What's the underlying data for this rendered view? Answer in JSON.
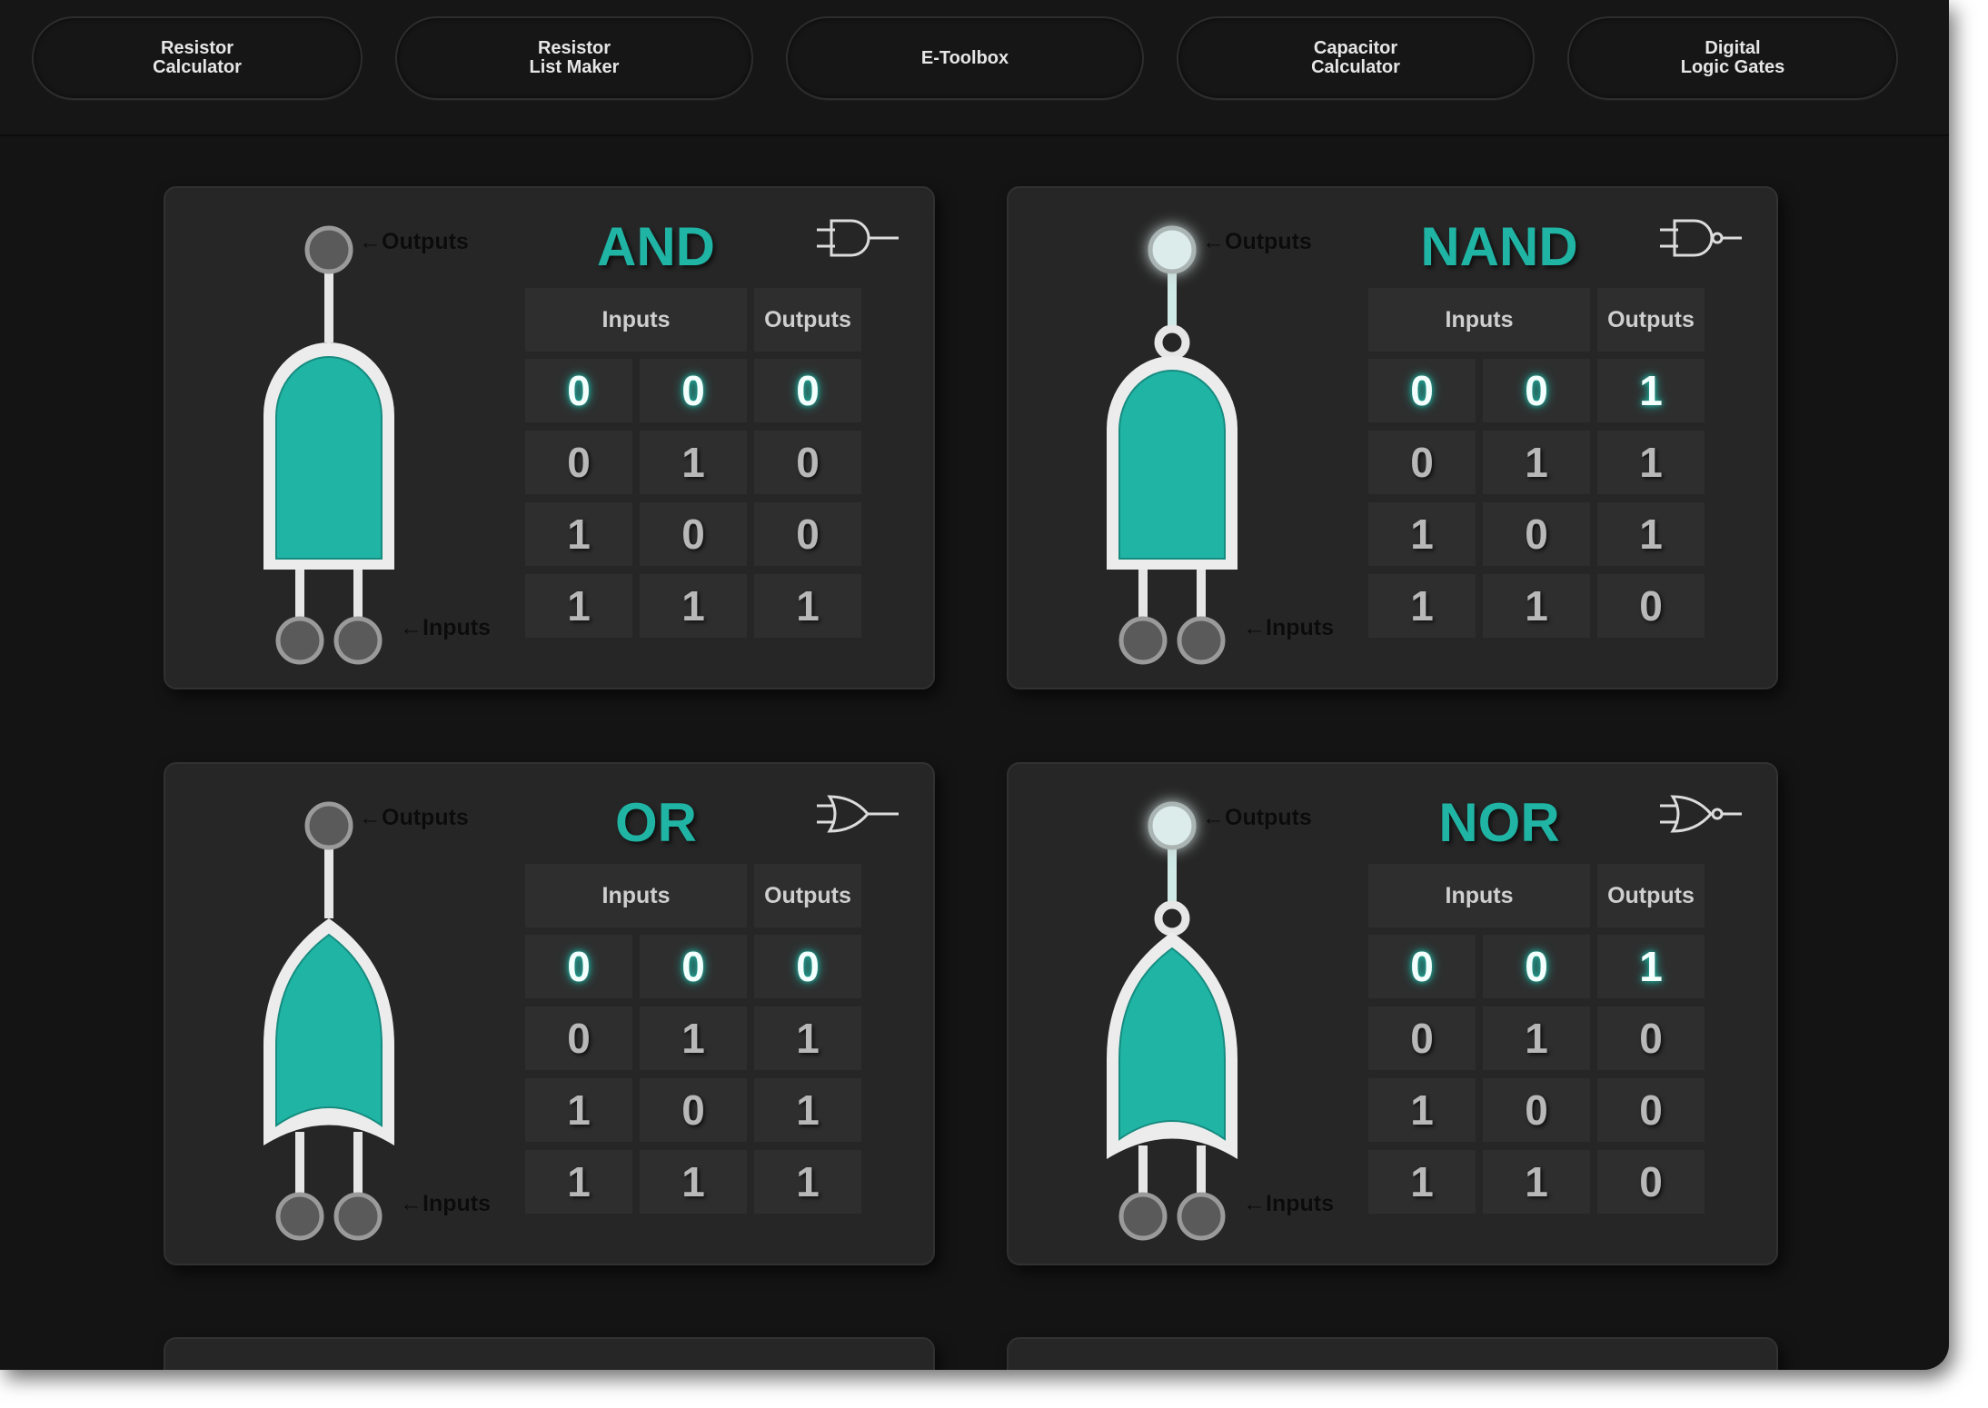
{
  "nav": [
    {
      "label": "Resistor\nCalculator"
    },
    {
      "label": "Resistor\nList Maker"
    },
    {
      "label": "E-Toolbox"
    },
    {
      "label": "Capacitor\nCalculator"
    },
    {
      "label": "Digital\nLogic Gates"
    }
  ],
  "labels": {
    "outputs": "←Outputs",
    "inputs": "←Inputs"
  },
  "colors": {
    "accent": "#20b4a4",
    "background": "#141414",
    "card": "#262626",
    "glow": "#cfe9e7"
  },
  "gates": [
    {
      "title": "AND",
      "shape": "and",
      "inverted": false,
      "output_lit": false,
      "headers": {
        "inputs": "Inputs",
        "outputs": "Outputs"
      },
      "rows": [
        [
          "0",
          "0",
          "0"
        ],
        [
          "0",
          "1",
          "0"
        ],
        [
          "1",
          "0",
          "0"
        ],
        [
          "1",
          "1",
          "1"
        ]
      ],
      "active_row": 0
    },
    {
      "title": "NAND",
      "shape": "and",
      "inverted": true,
      "output_lit": true,
      "headers": {
        "inputs": "Inputs",
        "outputs": "Outputs"
      },
      "rows": [
        [
          "0",
          "0",
          "1"
        ],
        [
          "0",
          "1",
          "1"
        ],
        [
          "1",
          "0",
          "1"
        ],
        [
          "1",
          "1",
          "0"
        ]
      ],
      "active_row": 0
    },
    {
      "title": "OR",
      "shape": "or",
      "inverted": false,
      "output_lit": false,
      "headers": {
        "inputs": "Inputs",
        "outputs": "Outputs"
      },
      "rows": [
        [
          "0",
          "0",
          "0"
        ],
        [
          "0",
          "1",
          "1"
        ],
        [
          "1",
          "0",
          "1"
        ],
        [
          "1",
          "1",
          "1"
        ]
      ],
      "active_row": 0
    },
    {
      "title": "NOR",
      "shape": "or",
      "inverted": true,
      "output_lit": true,
      "headers": {
        "inputs": "Inputs",
        "outputs": "Outputs"
      },
      "rows": [
        [
          "0",
          "0",
          "1"
        ],
        [
          "0",
          "1",
          "0"
        ],
        [
          "1",
          "0",
          "0"
        ],
        [
          "1",
          "1",
          "0"
        ]
      ],
      "active_row": 0
    }
  ]
}
